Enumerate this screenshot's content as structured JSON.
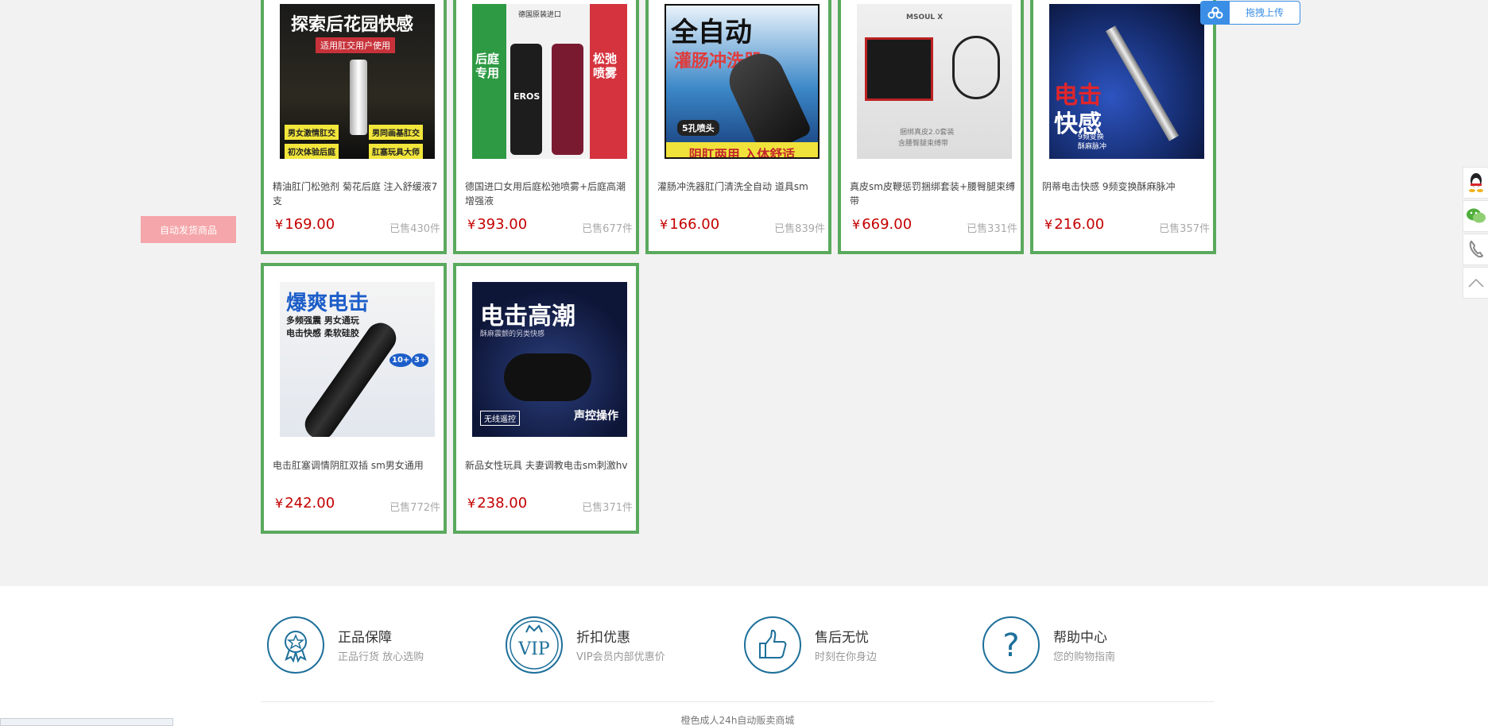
{
  "side": {
    "auto_button": "自动发货商品"
  },
  "upload": {
    "label": "拖拽上传",
    "icon": "cloud-share-icon"
  },
  "products": [
    {
      "title": "精油肛门松弛剂 菊花后庭 注入舒缓液7支",
      "price": "169.00",
      "sold": "已售430件",
      "image_text": [
        "探索后花园快感",
        "适用肛交用户使用",
        "男女激情肛交",
        "男同画基肛交",
        "初次体验后庭",
        "肛塞玩具大师"
      ]
    },
    {
      "title": "德国进口女用后庭松弛喷雾+后庭高潮增强液",
      "price": "393.00",
      "sold": "已售677件",
      "image_text": [
        "德国原装进口",
        "后庭专用",
        "松弛喷雾",
        "EROS"
      ]
    },
    {
      "title": "灌肠冲洗器肛门清洗全自动 道具sm",
      "price": "166.00",
      "sold": "已售839件",
      "image_text": [
        "全自动",
        "灌肠冲洗器",
        "5孔喷头",
        "阴肛两用 入体舒适"
      ]
    },
    {
      "title": "真皮sm皮鞭惩罚捆绑套装+腰臀腿束缚带",
      "price": "669.00",
      "sold": "已售331件",
      "image_text": [
        "MSOUL X",
        "捆绑真皮2.0套装",
        "含腰臀腿束缚带"
      ]
    },
    {
      "title": "阴蒂电击快感 9频变换酥麻脉冲",
      "price": "216.00",
      "sold": "已售357件",
      "image_text": [
        "电击",
        "快感",
        "9频变换",
        "酥麻脉冲"
      ]
    },
    {
      "title": "电击肛塞调情阴肛双插 sm男女通用",
      "price": "242.00",
      "sold": "已售772件",
      "image_text": [
        "爆爽电击",
        "多频强震 男女通玩",
        "电击快感 柔软硅胶",
        "10+",
        "3+"
      ]
    },
    {
      "title": "新品女性玩具 夫妻调教电击sm刺激hv",
      "price": "238.00",
      "sold": "已售371件",
      "image_text": [
        "电击高潮",
        "酥麻震颤的另类快感",
        "无线遥控",
        "声控操作"
      ]
    }
  ],
  "currency_symbol": "¥",
  "guarantees": [
    {
      "title": "正品保障",
      "subtitle": "正品行货 放心选购",
      "icon": "award-ribbon-icon"
    },
    {
      "title": "折扣优惠",
      "subtitle": "VIP会员内部优惠价",
      "icon": "vip-crown-icon",
      "icon_text": "VIP"
    },
    {
      "title": "售后无忧",
      "subtitle": "时刻在你身边",
      "icon": "thumbs-up-icon"
    },
    {
      "title": "帮助中心",
      "subtitle": "您的购物指南",
      "icon": "question-mark-icon",
      "icon_text": "?"
    }
  ],
  "footer": {
    "site_name": "橙色成人24h自动贩卖商城"
  },
  "side_tools": [
    "qq-icon",
    "wechat-icon",
    "phone-icon",
    "back-to-top-icon"
  ],
  "colors": {
    "card_border": "#5aa95d",
    "price": "#c40000",
    "accent_blue": "#1d6f9a",
    "upload_blue": "#3a8ee6",
    "side_button": "#f5a6aa"
  }
}
